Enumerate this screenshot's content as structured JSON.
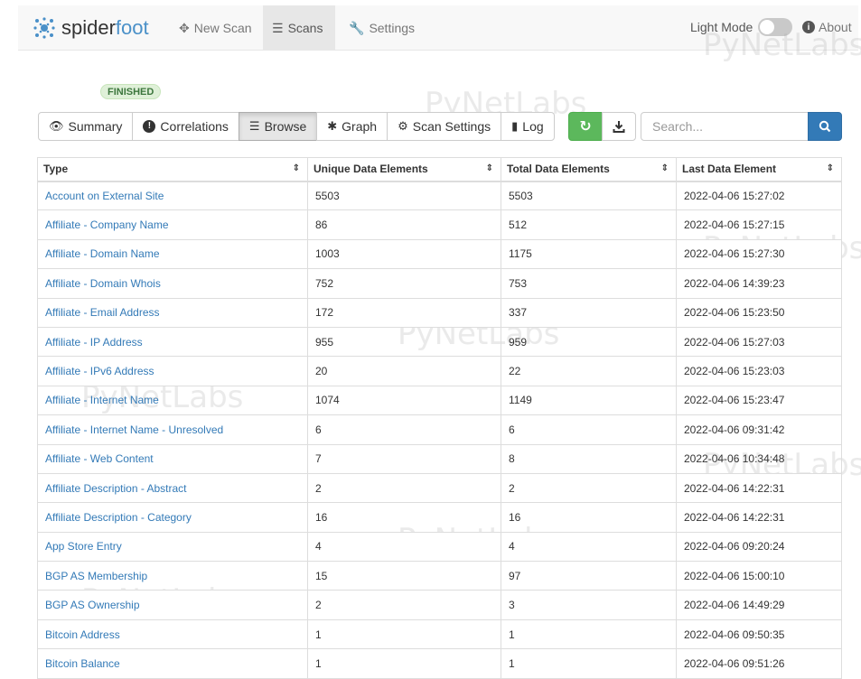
{
  "nav": {
    "brand_prefix": "spider",
    "brand_suffix": "foot",
    "new_scan": "New Scan",
    "scans": "Scans",
    "settings": "Settings",
    "light_mode": "Light Mode",
    "about": "About"
  },
  "scan": {
    "status": "FINISHED"
  },
  "tabs": [
    {
      "label": "Summary",
      "icon": "eye-icon"
    },
    {
      "label": "Correlations",
      "icon": "exclamation-icon"
    },
    {
      "label": "Browse",
      "icon": "list-icon",
      "active": true
    },
    {
      "label": "Graph",
      "icon": "asterisk-icon"
    },
    {
      "label": "Scan Settings",
      "icon": "gear-icon"
    },
    {
      "label": "Log",
      "icon": "book-icon"
    }
  ],
  "search": {
    "placeholder": "Search..."
  },
  "table": {
    "headers": [
      "Type",
      "Unique Data Elements",
      "Total Data Elements",
      "Last Data Element"
    ],
    "rows": [
      [
        "Account on External Site",
        "5503",
        "5503",
        "2022-04-06 15:27:02"
      ],
      [
        "Affiliate - Company Name",
        "86",
        "512",
        "2022-04-06 15:27:15"
      ],
      [
        "Affiliate - Domain Name",
        "1003",
        "1175",
        "2022-04-06 15:27:30"
      ],
      [
        "Affiliate - Domain Whois",
        "752",
        "753",
        "2022-04-06 14:39:23"
      ],
      [
        "Affiliate - Email Address",
        "172",
        "337",
        "2022-04-06 15:23:50"
      ],
      [
        "Affiliate - IP Address",
        "955",
        "959",
        "2022-04-06 15:27:03"
      ],
      [
        "Affiliate - IPv6 Address",
        "20",
        "22",
        "2022-04-06 15:23:03"
      ],
      [
        "Affiliate - Internet Name",
        "1074",
        "1149",
        "2022-04-06 15:23:47"
      ],
      [
        "Affiliate - Internet Name - Unresolved",
        "6",
        "6",
        "2022-04-06 09:31:42"
      ],
      [
        "Affiliate - Web Content",
        "7",
        "8",
        "2022-04-06 10:34:48"
      ],
      [
        "Affiliate Description - Abstract",
        "2",
        "2",
        "2022-04-06 14:22:31"
      ],
      [
        "Affiliate Description - Category",
        "16",
        "16",
        "2022-04-06 14:22:31"
      ],
      [
        "App Store Entry",
        "4",
        "4",
        "2022-04-06 09:20:24"
      ],
      [
        "BGP AS Membership",
        "15",
        "97",
        "2022-04-06 15:00:10"
      ],
      [
        "BGP AS Ownership",
        "2",
        "3",
        "2022-04-06 14:49:29"
      ],
      [
        "Bitcoin Address",
        "1",
        "1",
        "2022-04-06 09:50:35"
      ],
      [
        "Bitcoin Balance",
        "1",
        "1",
        "2022-04-06 09:51:26"
      ]
    ]
  },
  "watermark": "PyNetLabs"
}
